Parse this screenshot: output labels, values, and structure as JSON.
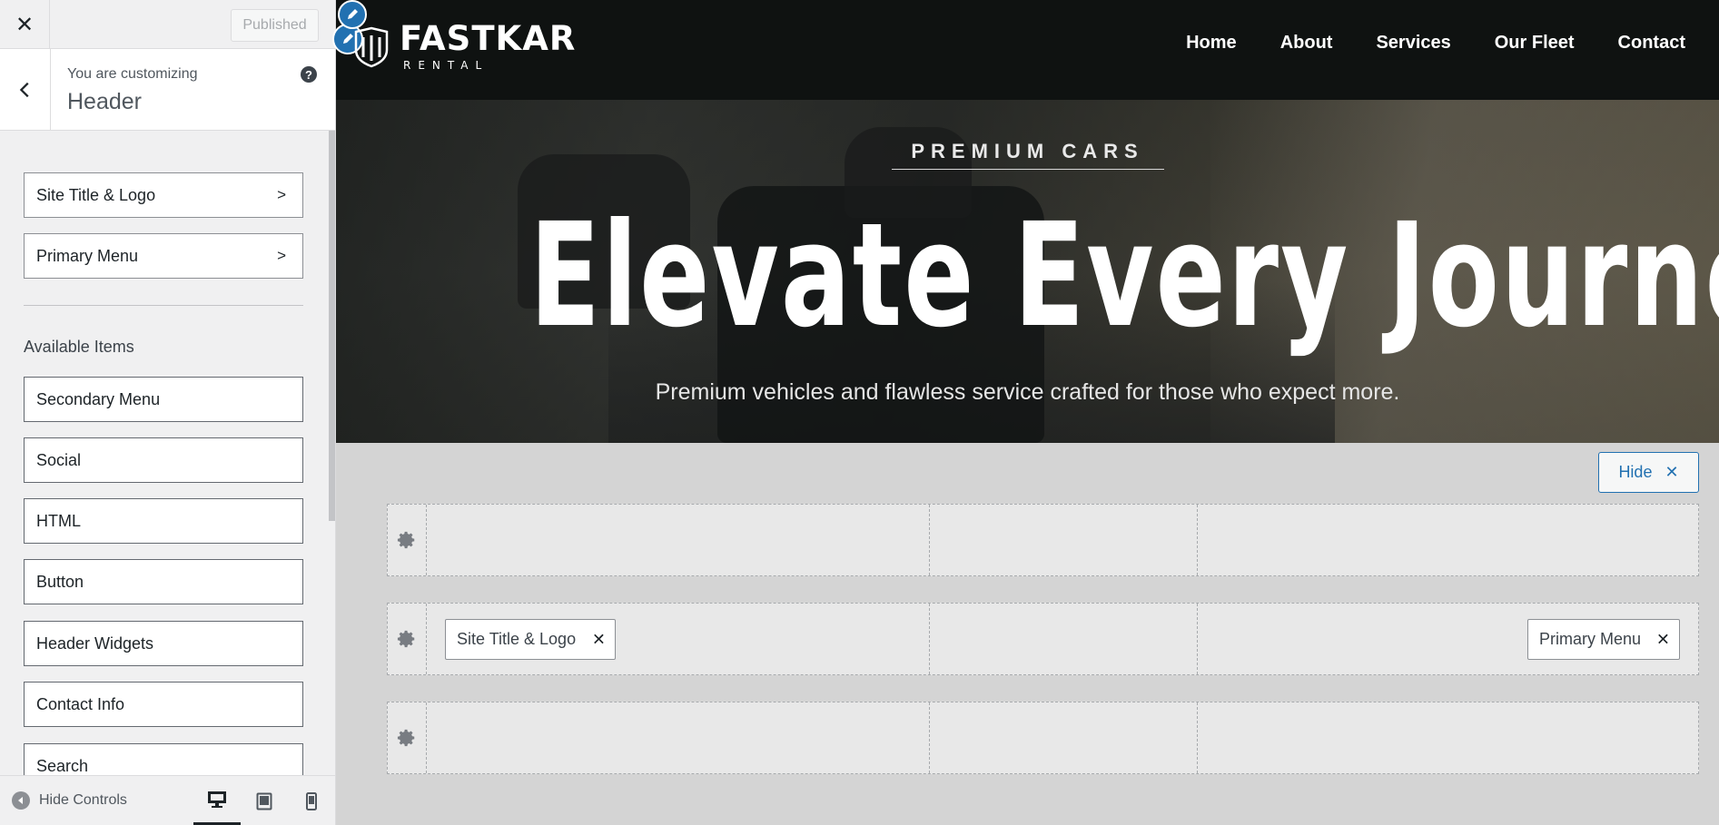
{
  "topbar": {
    "close_glyph": "✕",
    "published_label": "Published"
  },
  "panel": {
    "customizing_label": "You are customizing",
    "section_title": "Header",
    "help_glyph": "?"
  },
  "sections": [
    {
      "label": "Site Title & Logo"
    },
    {
      "label": "Primary Menu"
    }
  ],
  "available": {
    "title": "Available Items",
    "items": [
      {
        "label": "Secondary Menu"
      },
      {
        "label": "Social"
      },
      {
        "label": "HTML"
      },
      {
        "label": "Button"
      },
      {
        "label": "Header Widgets"
      },
      {
        "label": "Contact Info"
      },
      {
        "label": "Search"
      }
    ]
  },
  "footer": {
    "hide_controls_label": "Hide Controls",
    "devices": [
      "desktop-icon",
      "tablet-icon",
      "mobile-icon"
    ],
    "active_device": "desktop"
  },
  "site": {
    "logo_word": "FASTKAR",
    "logo_sub": "RENTAL",
    "menu": [
      "Home",
      "About",
      "Services",
      "Our Fleet",
      "Contact"
    ]
  },
  "hero": {
    "eyebrow": "PREMIUM CARS",
    "title": "Elevate Every Journey",
    "subtitle": "Premium vehicles and flawless service crafted for those who expect more."
  },
  "builder": {
    "hide_label": "Hide",
    "hide_glyph": "✕",
    "chip_close_glyph": "✕",
    "main_row": {
      "left_chip": "Site Title & Logo",
      "right_chip": "Primary Menu"
    }
  },
  "colors": {
    "accent": "#2271b1",
    "header_bg": "#0f1211",
    "panel_bg": "#f0f0f1"
  }
}
